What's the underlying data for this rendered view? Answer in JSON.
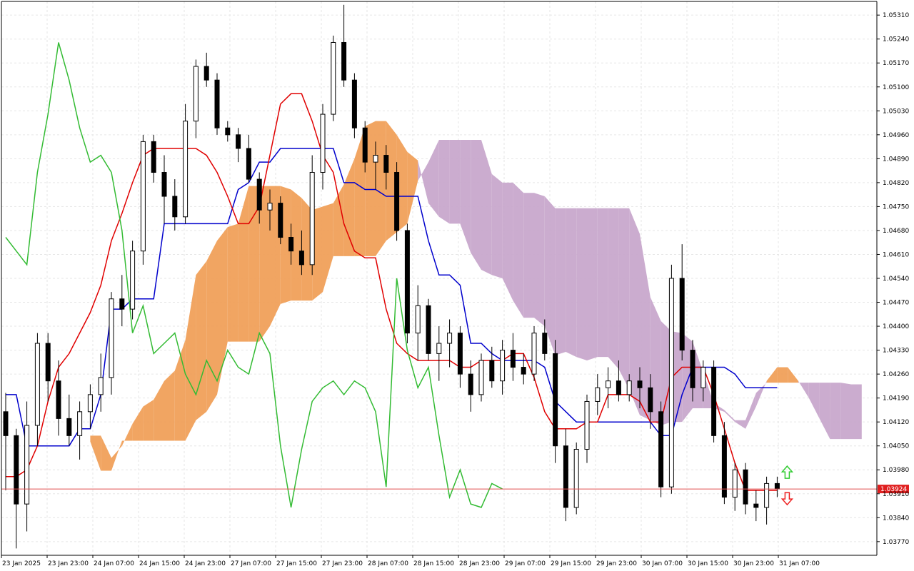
{
  "chart_data": {
    "type": "candlestick",
    "title": "",
    "xlabel": "",
    "ylabel": "",
    "ylim": [
      1.0373,
      1.0535
    ],
    "grid": true,
    "legend": "none",
    "y_ticks": [
      "1.05310",
      "1.05240",
      "1.05170",
      "1.05100",
      "1.05030",
      "1.04960",
      "1.04890",
      "1.04820",
      "1.04750",
      "1.04680",
      "1.04610",
      "1.04540",
      "1.04470",
      "1.04400",
      "1.04330",
      "1.04260",
      "1.04190",
      "1.04120",
      "1.04050",
      "1.03980",
      "1.03910",
      "1.03840",
      "1.03770"
    ],
    "x_tick_labels": [
      "23 Jan 2025",
      "23 Jan 23:00",
      "24 Jan 07:00",
      "24 Jan 15:00",
      "24 Jan 23:00",
      "27 Jan 07:00",
      "27 Jan 15:00",
      "27 Jan 23:00",
      "28 Jan 07:00",
      "28 Jan 15:00",
      "28 Jan 23:00",
      "29 Jan 07:00",
      "29 Jan 15:00",
      "29 Jan 23:00",
      "30 Jan 07:00",
      "30 Jan 15:00",
      "30 Jan 23:00",
      "31 Jan 07:00"
    ],
    "current_price": "1.03924",
    "colors": {
      "tenkan": "#e00000",
      "kijun": "#0000cc",
      "chikou": "#33bb33",
      "kumo_bull": "#f0a05a",
      "kumo_bear": "#c8a8cc",
      "candle": "#000000",
      "price_line": "#e05050",
      "price_tag": "#e02020",
      "arrow_up": "#33cc33",
      "arrow_down": "#ee2222"
    },
    "series": {
      "candles": [
        [
          1.0415,
          1.04205,
          1.0392,
          1.0408
        ],
        [
          1.0408,
          1.041,
          1.0375,
          1.0388
        ],
        [
          1.0388,
          1.0418,
          1.038,
          1.0411
        ],
        [
          1.0411,
          1.0438,
          1.0405,
          1.0435
        ],
        [
          1.0435,
          1.0438,
          1.0418,
          1.0424
        ],
        [
          1.0424,
          1.043,
          1.0408,
          1.0413
        ],
        [
          1.0413,
          1.042,
          1.0405,
          1.0408
        ],
        [
          1.0408,
          1.0418,
          1.0401,
          1.0415
        ],
        [
          1.0415,
          1.0423,
          1.041,
          1.042
        ],
        [
          1.042,
          1.0432,
          1.0415,
          1.0425
        ],
        [
          1.0425,
          1.045,
          1.042,
          1.0448
        ],
        [
          1.0448,
          1.0455,
          1.044,
          1.0445
        ],
        [
          1.0445,
          1.0465,
          1.0442,
          1.0462
        ],
        [
          1.0462,
          1.0496,
          1.0458,
          1.0494
        ],
        [
          1.0494,
          1.0496,
          1.0482,
          1.0485
        ],
        [
          1.0485,
          1.049,
          1.047,
          1.0478
        ],
        [
          1.0478,
          1.0483,
          1.0468,
          1.0472
        ],
        [
          1.0472,
          1.0505,
          1.047,
          1.05
        ],
        [
          1.05,
          1.0518,
          1.0495,
          1.0516
        ],
        [
          1.0516,
          1.052,
          1.051,
          1.0512
        ],
        [
          1.0512,
          1.0514,
          1.0496,
          1.0498
        ],
        [
          1.0498,
          1.05,
          1.0494,
          1.0496
        ],
        [
          1.0496,
          1.0498,
          1.0488,
          1.0492
        ],
        [
          1.0492,
          1.0496,
          1.0482,
          1.0483
        ],
        [
          1.0483,
          1.0485,
          1.047,
          1.0474
        ],
        [
          1.0474,
          1.048,
          1.0468,
          1.0476
        ],
        [
          1.0476,
          1.0478,
          1.0464,
          1.0466
        ],
        [
          1.0466,
          1.047,
          1.0458,
          1.0462
        ],
        [
          1.0462,
          1.0468,
          1.0455,
          1.0458
        ],
        [
          1.0458,
          1.049,
          1.0455,
          1.0485
        ],
        [
          1.0485,
          1.0505,
          1.048,
          1.0502
        ],
        [
          1.0502,
          1.0525,
          1.05,
          1.0523
        ],
        [
          1.0523,
          1.0534,
          1.051,
          1.0512
        ],
        [
          1.0512,
          1.0514,
          1.0495,
          1.0498
        ],
        [
          1.0498,
          1.05,
          1.0485,
          1.0488
        ],
        [
          1.0488,
          1.0494,
          1.048,
          1.049
        ],
        [
          1.049,
          1.0493,
          1.048,
          1.0485
        ],
        [
          1.0485,
          1.0488,
          1.0465,
          1.0468
        ],
        [
          1.0468,
          1.047,
          1.0435,
          1.0438
        ],
        [
          1.0438,
          1.0452,
          1.043,
          1.0446
        ],
        [
          1.0446,
          1.0448,
          1.043,
          1.0432
        ],
        [
          1.0432,
          1.044,
          1.0424,
          1.0435
        ],
        [
          1.0435,
          1.0442,
          1.0428,
          1.0438
        ],
        [
          1.0438,
          1.044,
          1.0422,
          1.0426
        ],
        [
          1.0426,
          1.043,
          1.0415,
          1.042
        ],
        [
          1.042,
          1.0432,
          1.0418,
          1.043
        ],
        [
          1.043,
          1.0434,
          1.0422,
          1.0424
        ],
        [
          1.0424,
          1.0436,
          1.042,
          1.0433
        ],
        [
          1.0433,
          1.0438,
          1.0424,
          1.0428
        ],
        [
          1.0428,
          1.0432,
          1.0423,
          1.0426
        ],
        [
          1.0426,
          1.044,
          1.0424,
          1.0438
        ],
        [
          1.0438,
          1.0442,
          1.043,
          1.0432
        ],
        [
          1.0432,
          1.0436,
          1.04,
          1.0405
        ],
        [
          1.0405,
          1.041,
          1.0383,
          1.0387
        ],
        [
          1.0387,
          1.0406,
          1.0385,
          1.0404
        ],
        [
          1.0404,
          1.042,
          1.04,
          1.0418
        ],
        [
          1.0418,
          1.0426,
          1.0414,
          1.0422
        ],
        [
          1.0422,
          1.0428,
          1.0416,
          1.0424
        ],
        [
          1.0424,
          1.043,
          1.0418,
          1.042
        ],
        [
          1.042,
          1.0426,
          1.0418,
          1.0424
        ],
        [
          1.0424,
          1.0428,
          1.0416,
          1.0422
        ],
        [
          1.0422,
          1.0426,
          1.041,
          1.0415
        ],
        [
          1.0415,
          1.0418,
          1.039,
          1.0393
        ],
        [
          1.0393,
          1.0458,
          1.0391,
          1.0454
        ],
        [
          1.0454,
          1.0464,
          1.043,
          1.0433
        ],
        [
          1.0433,
          1.0436,
          1.0418,
          1.0422
        ],
        [
          1.0422,
          1.043,
          1.0418,
          1.0428
        ],
        [
          1.0428,
          1.043,
          1.0406,
          1.0408
        ],
        [
          1.0408,
          1.0412,
          1.0388,
          1.039
        ],
        [
          1.039,
          1.04,
          1.0386,
          1.0398
        ],
        [
          1.0398,
          1.04,
          1.0385,
          1.0388
        ],
        [
          1.0388,
          1.0392,
          1.0383,
          1.0387
        ],
        [
          1.0387,
          1.0396,
          1.0382,
          1.0394
        ],
        [
          1.0394,
          1.0396,
          1.039,
          1.03924
        ]
      ],
      "tenkan": [
        1.0396,
        1.0396,
        1.0398,
        1.0405,
        1.0418,
        1.0428,
        1.0432,
        1.0438,
        1.0444,
        1.0452,
        1.0465,
        1.0473,
        1.0482,
        1.049,
        1.0492,
        1.0492,
        1.0492,
        1.0492,
        1.0492,
        1.049,
        1.0485,
        1.0478,
        1.047,
        1.047,
        1.0475,
        1.049,
        1.0505,
        1.0508,
        1.0508,
        1.05,
        1.049,
        1.0485,
        1.047,
        1.0462,
        1.046,
        1.046,
        1.0445,
        1.0435,
        1.0432,
        1.043,
        1.043,
        1.043,
        1.043,
        1.0428,
        1.0428,
        1.043,
        1.043,
        1.043,
        1.0432,
        1.0432,
        1.0425,
        1.0415,
        1.041,
        1.041,
        1.041,
        1.0412,
        1.0412,
        1.042,
        1.042,
        1.042,
        1.0418,
        1.0412,
        1.0412,
        1.0425,
        1.0428,
        1.0428,
        1.0428,
        1.042,
        1.041,
        1.04,
        1.0392,
        1.0392,
        1.0392,
        1.0392
      ],
      "kijun": [
        1.042,
        1.042,
        1.0405,
        1.0405,
        1.0405,
        1.0405,
        1.0405,
        1.041,
        1.041,
        1.042,
        1.0445,
        1.0445,
        1.0448,
        1.0448,
        1.0448,
        1.047,
        1.047,
        1.047,
        1.047,
        1.047,
        1.047,
        1.047,
        1.048,
        1.0482,
        1.0488,
        1.0488,
        1.0492,
        1.0492,
        1.0492,
        1.0492,
        1.0492,
        1.0492,
        1.0482,
        1.0482,
        1.048,
        1.048,
        1.0478,
        1.0478,
        1.0478,
        1.0478,
        1.0465,
        1.0455,
        1.0455,
        1.0452,
        1.0435,
        1.0435,
        1.0432,
        1.043,
        1.043,
        1.043,
        1.043,
        1.0428,
        1.0418,
        1.0415,
        1.0412,
        1.0412,
        1.0412,
        1.0412,
        1.0412,
        1.0412,
        1.0412,
        1.0412,
        1.0408,
        1.0408,
        1.042,
        1.0428,
        1.0428,
        1.0428,
        1.0428,
        1.0426,
        1.0422,
        1.0422,
        1.0422,
        1.0422
      ]
    }
  }
}
